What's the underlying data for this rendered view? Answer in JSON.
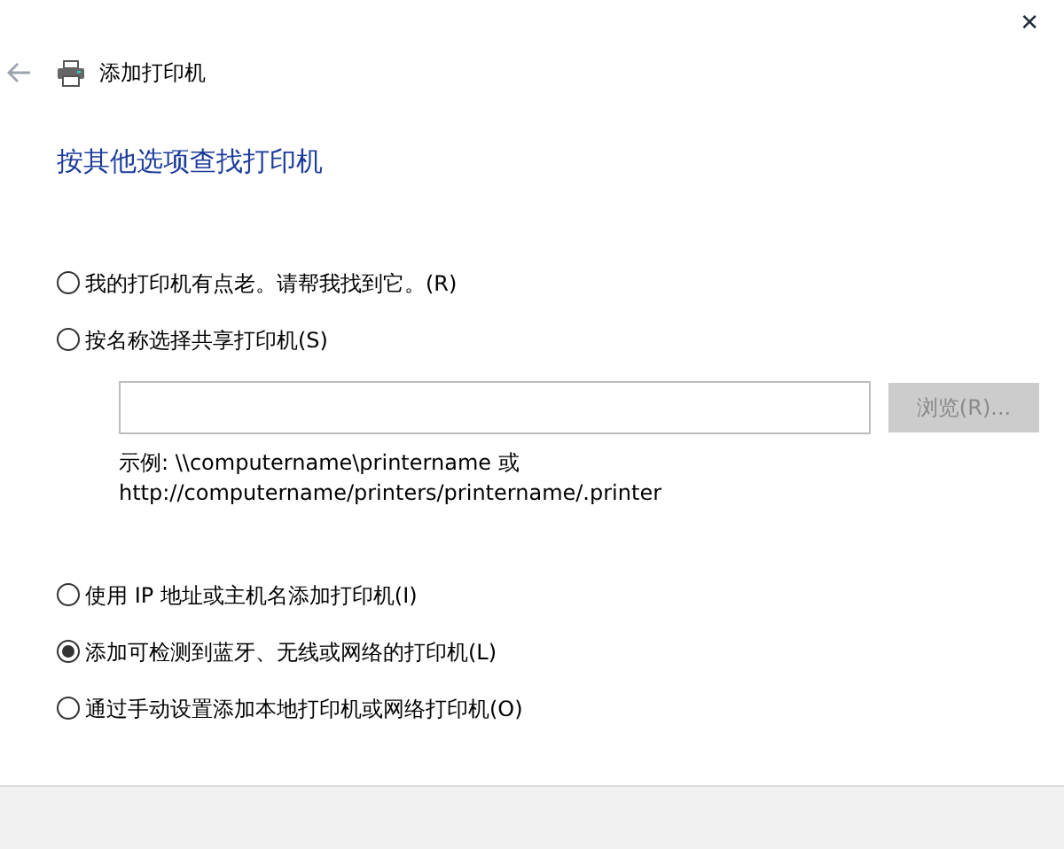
{
  "window": {
    "title": "添加打印机",
    "close": "✕"
  },
  "heading": "按其他选项查找打印机",
  "options": [
    {
      "label": "我的打印机有点老。请帮我找到它。(R)",
      "selected": false
    },
    {
      "label": "按名称选择共享打印机(S)",
      "selected": false,
      "share": {
        "browse": {
          "label": "浏览(R)...",
          "disabled": true
        },
        "example": [
          "示例: \\\\computername\\printername 或",
          "http://computername/printers/printername/.printer"
        ]
      }
    },
    {
      "label": "使用 IP 地址或主机名添加打印机(I)",
      "selected": false
    },
    {
      "label": "添加可检测到蓝牙、无线或网络的打印机(L)",
      "selected": true
    },
    {
      "label": "通过手动设置添加本地打印机或网络打印机(O)",
      "selected": false
    }
  ]
}
